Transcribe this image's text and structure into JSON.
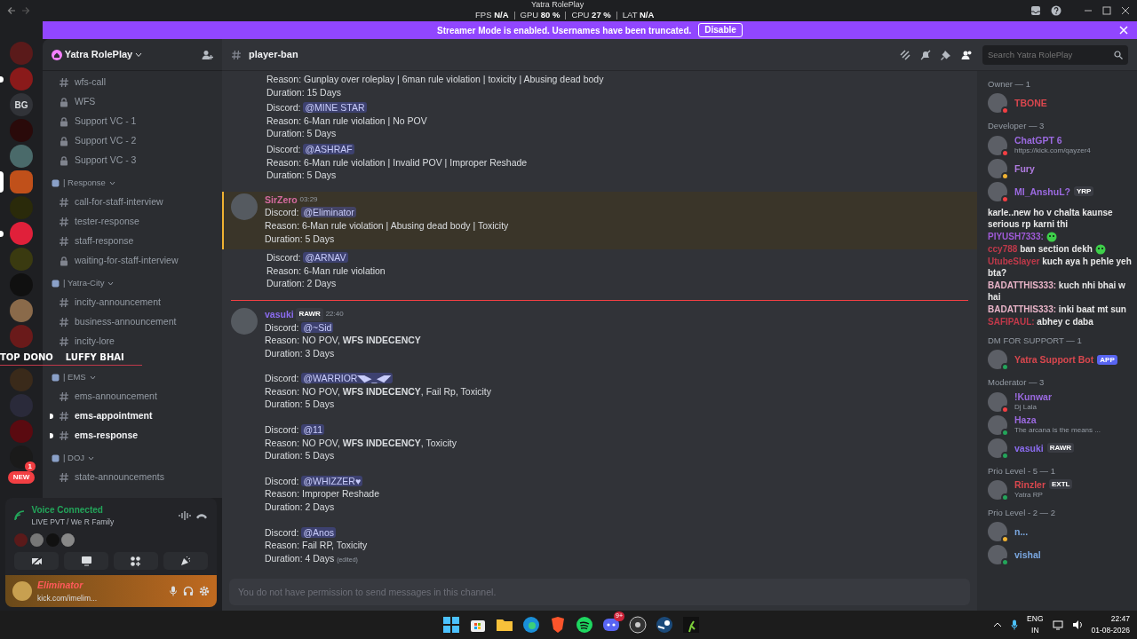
{
  "titlebar": {
    "title": "Yatra RolePlay",
    "perf": [
      {
        "label": "FPS",
        "value": "N/A"
      },
      {
        "label": "GPU",
        "value": "80 %"
      },
      {
        "label": "CPU",
        "value": "27 %"
      },
      {
        "label": "LAT",
        "value": "N/A"
      }
    ]
  },
  "banner": {
    "text": "Streamer Mode is enabled. Usernames have been truncated.",
    "button": "Disable"
  },
  "servers": [
    {
      "kind": "image",
      "color": "#5a1a1a",
      "selected": false,
      "unread": false
    },
    {
      "kind": "image",
      "color": "#8a1a1a",
      "selected": false,
      "unread": true
    },
    {
      "kind": "text",
      "label": "BG",
      "selected": false,
      "unread": false
    },
    {
      "kind": "image",
      "color": "#2a0a0a",
      "selected": false,
      "unread": false
    },
    {
      "kind": "image",
      "color": "#4a6a6a",
      "selected": false,
      "unread": false
    },
    {
      "kind": "image",
      "color": "#c0501a",
      "selected": true,
      "unread": false
    },
    {
      "kind": "image",
      "color": "#2a2a0a",
      "selected": false,
      "unread": false
    },
    {
      "kind": "image",
      "color": "#e0203a",
      "selected": false,
      "unread": true
    },
    {
      "kind": "image",
      "color": "#3a3a10",
      "selected": false,
      "unread": false
    },
    {
      "kind": "image",
      "color": "#101010",
      "selected": false,
      "unread": false
    },
    {
      "kind": "image",
      "color": "#8a6a4a",
      "selected": false,
      "unread": false
    },
    {
      "kind": "image",
      "color": "#6a1a1a",
      "selected": false,
      "unread": false
    },
    {
      "kind": "image",
      "color": "#3a2a1a",
      "selected": false,
      "unread": false
    },
    {
      "kind": "image",
      "color": "#2a2a3a",
      "selected": false,
      "unread": false
    },
    {
      "kind": "image",
      "color": "#5a0a10",
      "selected": false,
      "unread": false
    },
    {
      "kind": "image",
      "color": "#1a1a1a",
      "selected": false,
      "unread": false,
      "badge": "1"
    },
    {
      "kind": "new",
      "label": "NEW"
    }
  ],
  "stream_overlay": {
    "names": [
      "TOP DONO",
      "LUFFY BHAI"
    ]
  },
  "sidebar": {
    "server_name": "Yatra RolePlay",
    "channels": [
      {
        "kind": "text",
        "name": "wfs-call",
        "unread": false
      },
      {
        "kind": "locked",
        "name": "WFS",
        "unread": false
      },
      {
        "kind": "locked",
        "name": "Support VC - 1",
        "unread": false
      },
      {
        "kind": "locked",
        "name": "Support VC - 2",
        "unread": false
      },
      {
        "kind": "locked",
        "name": "Support VC - 3",
        "unread": false
      },
      {
        "kind": "category",
        "name": "| Response"
      },
      {
        "kind": "text",
        "name": "call-for-staff-interview",
        "unread": false
      },
      {
        "kind": "text",
        "name": "tester-response",
        "unread": false
      },
      {
        "kind": "text",
        "name": "staff-response",
        "unread": false
      },
      {
        "kind": "locked",
        "name": "waiting-for-staff-interview",
        "unread": false
      },
      {
        "kind": "category",
        "name": "| Yatra-City"
      },
      {
        "kind": "text",
        "name": "incity-announcement",
        "unread": false
      },
      {
        "kind": "text",
        "name": "business-announcement",
        "unread": false
      },
      {
        "kind": "text",
        "name": "incity-lore",
        "unread": false
      },
      {
        "kind": "category",
        "name": "| EMS"
      },
      {
        "kind": "text",
        "name": "ems-announcement",
        "unread": false
      },
      {
        "kind": "text",
        "name": "ems-appointment",
        "unread": true
      },
      {
        "kind": "text",
        "name": "ems-response",
        "unread": true
      },
      {
        "kind": "category",
        "name": "| DOJ"
      },
      {
        "kind": "text",
        "name": "state-announcements",
        "unread": false
      }
    ]
  },
  "voice": {
    "title": "Voice Connected",
    "channel": "LIVE PVT / We R Family"
  },
  "user": {
    "name": "Eliminator",
    "status": "kick.com/imelim..."
  },
  "channel_header": {
    "name": "player-ban",
    "search_placeholder": "Search Yatra RolePlay"
  },
  "messages": [
    {
      "highlighted": false,
      "new_divider": false,
      "entries": [
        {
          "reason": "Reason: Gunplay over roleplay | 6man rule violation | toxicity | Abusing dead body",
          "duration": "Duration: 15 Days"
        },
        {
          "label": "Discord:",
          "mention": "@MINE STAR",
          "reason": "Reason: 6-Man rule violation | No POV",
          "duration": "Duration: 5 Days"
        },
        {
          "label": "Discord:",
          "mention": "@ASHRAF",
          "reason": "Reason: 6-Man rule violation | Invalid POV | Improper Reshade",
          "duration": "Duration: 5 Days"
        }
      ]
    },
    {
      "author": "SirZero",
      "color": "#d46a9e",
      "time": "03:29",
      "highlighted": true,
      "new_divider": false,
      "entries": [
        {
          "label": "Discord:",
          "mention": "@Eliminator",
          "reason": "Reason: 6-Man rule violation | Abusing dead body | Toxicity",
          "duration": "Duration: 5 Days"
        }
      ]
    },
    {
      "highlighted": false,
      "new_divider": false,
      "entries": [
        {
          "label": "Discord:",
          "mention": "@ARNAV",
          "reason": "Reason: 6-Man rule violation",
          "duration": "Duration: 2 Days"
        }
      ]
    },
    {
      "author": "vasuki",
      "color": "#8b6cf0",
      "tag": "RAWR",
      "time": "22:40",
      "highlighted": false,
      "new_divider": true,
      "spaced": true,
      "entries": [
        {
          "label": "Discord:",
          "mention": "@~Sid",
          "reason": "Reason: NO POV, **WFS INDECENCY**",
          "duration": "Duration: 3 Days"
        },
        {
          "label": "Discord:",
          "mention": "@WARRIOR◥▶_◀◤",
          "reason": "Reason: NO POV, **WFS INDECENCY**, Fail Rp, Toxicity",
          "duration": "Duration: 5 Days"
        },
        {
          "label": "Discord:",
          "mention": "@11",
          "reason": "Reason: NO POV, **WFS INDECENCY**, Toxicity",
          "duration": "Duration: 5 Days"
        },
        {
          "label": "Discord:",
          "mention": "@WHIZZER♥",
          "reason": "Reason: Improper Reshade",
          "duration": "Duration: 2 Days"
        },
        {
          "label": "Discord:",
          "mention": "@Anos",
          "reason": "Reason: Fail RP, Toxicity",
          "duration": "Duration: 4 Days",
          "edited": "(edited)"
        }
      ]
    }
  ],
  "composer": {
    "placeholder": "You do not have permission to send messages in this channel."
  },
  "member_groups": [
    {
      "header": "Owner — 1",
      "members": [
        {
          "name": "TBONE",
          "color": "#d9474e",
          "status_dot": {
            "color": "#f23f43"
          }
        }
      ]
    },
    {
      "header": "Developer — 3",
      "members": [
        {
          "name": "ChatGPT 6",
          "color": "#9b6ae0",
          "status_dot": {
            "color": "#f23f43"
          },
          "activity": "https://kick.com/qayzer4"
        },
        {
          "name": "Fury",
          "color": "#b07be0",
          "status_dot": {
            "color": "#f0b232"
          }
        },
        {
          "name": "MI_AnshuL?",
          "color": "#9b6ae0",
          "status_dot": {
            "color": "#f23f43"
          },
          "tag": {
            "label": "YRP",
            "kind": "guild"
          }
        }
      ]
    }
  ],
  "stream_chat": [
    {
      "text": "karle..new ho v chalta kaunse serious rp karni thi"
    },
    {
      "name": "PIYUSH7333:",
      "color": "#a05ad8",
      "sticker": true
    },
    {
      "name": "ccy788",
      "color": "#c0394a",
      "text": "ban section dekh",
      "sticker": true
    },
    {
      "name": "UtubeSlayer",
      "color": "#c0394a",
      "text": "kuch aya h pehle yeh bta?"
    },
    {
      "name": "BADATTHIS333:",
      "color": "#e8b4c8",
      "text": "kuch nhi bhai w hai"
    },
    {
      "name": "BADATTHIS333:",
      "color": "#e8b4c8",
      "text": "inki baat mt sun"
    },
    {
      "name": "SAFIPAUL:",
      "color": "#c0394a",
      "text": "abhey c daba"
    }
  ],
  "member_groups_after": [
    {
      "header": "DM FOR SUPPORT — 1",
      "members": [
        {
          "name": "Yatra Support Bot",
          "color": "#d9474e",
          "status_dot": {
            "color": "#23a55a"
          },
          "tag": {
            "label": "APP",
            "kind": "app"
          }
        }
      ]
    },
    {
      "header": "Moderator — 3",
      "members": [
        {
          "name": "!Kunwar",
          "color": "#9b6ae0",
          "status_dot": {
            "color": "#f23f43"
          },
          "activity": "Dj Lala"
        },
        {
          "name": "Haza",
          "color": "#9b6ae0",
          "status_dot": {
            "color": "#23a55a"
          },
          "activity": "The arcana is the means ..."
        },
        {
          "name": "vasuki",
          "color": "#8b6cf0",
          "status_dot": {
            "color": "#23a55a"
          },
          "tag": {
            "label": "RAWR",
            "kind": "guild"
          }
        }
      ]
    },
    {
      "header": "Prio Level - 5 — 1",
      "members": [
        {
          "name": "Rinzler",
          "color": "#d9474e",
          "status_dot": {
            "color": "#23a55a"
          },
          "activity": "Yatra RP",
          "tag": {
            "label": "EXTL",
            "kind": "guild"
          }
        }
      ]
    },
    {
      "header": "Prio Level - 2 — 2",
      "members": [
        {
          "name": "n...",
          "color": "#7aa7e0",
          "status_dot": {
            "color": "#f0b232"
          }
        },
        {
          "name": "vishal",
          "color": "#7aa7e0",
          "status_dot": {
            "color": "#23a55a"
          }
        }
      ]
    }
  ],
  "taskbar": {
    "apps": [
      {
        "kind": "start"
      },
      {
        "kind": "store"
      },
      {
        "kind": "folder"
      },
      {
        "kind": "edge"
      },
      {
        "kind": "brave"
      },
      {
        "kind": "spotify"
      },
      {
        "kind": "discord",
        "badge": "9+"
      },
      {
        "kind": "obs"
      },
      {
        "kind": "steam"
      },
      {
        "kind": "runner"
      }
    ],
    "language": "ENG",
    "region": "IN",
    "time": "22:47",
    "date": "01-08-2026"
  }
}
